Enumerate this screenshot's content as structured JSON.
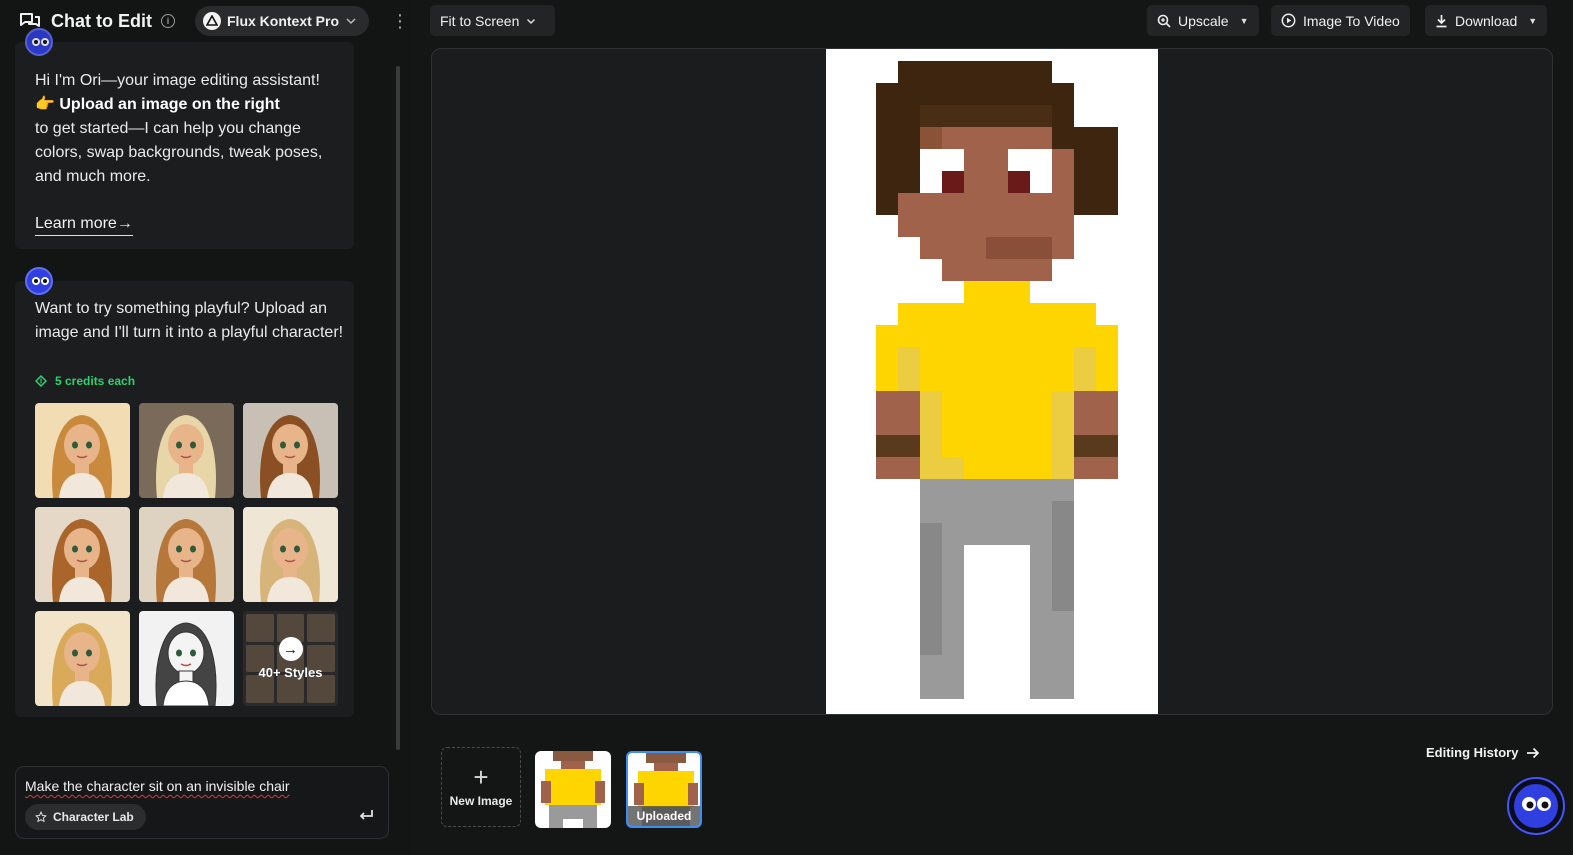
{
  "header": {
    "title": "Chat to Edit",
    "model_name": "Flux Kontext Pro"
  },
  "messages": [
    {
      "intro": "Hi I'm Ori—your image editing assistant!",
      "highlight_emoji": "👉",
      "highlight": "Upload an image on the right",
      "body": "to get started—I can help you change colors, swap backgrounds, tweak poses, and much more.",
      "link": "Learn more",
      "link_arrow": "→"
    },
    {
      "body": "Want to try something playful? Upload an image and I'll turn it into a playful character!",
      "credits": "5 credits each",
      "styles_more": "40+ Styles"
    }
  ],
  "style_thumbs": [
    {
      "icon": "cartoon-girl-style-1",
      "bg": "#f2dcb4",
      "hair": "#c98a3e"
    },
    {
      "icon": "photo-girl-waving-style-2",
      "bg": "#7a6a5a",
      "hair": "#e8d6a8"
    },
    {
      "icon": "cartoon-girl-style-3",
      "bg": "#c9c0b5",
      "hair": "#8a4f22"
    },
    {
      "icon": "cartoon-girl-style-4",
      "bg": "#e6d8c6",
      "hair": "#a9652a"
    },
    {
      "icon": "chibi-girl-style-5",
      "bg": "#ddd3c0",
      "hair": "#b6773a"
    },
    {
      "icon": "anime-girl-style-6",
      "bg": "#efe6d6",
      "hair": "#d6b47a"
    },
    {
      "icon": "cartoon-girl-style-7",
      "bg": "#f2e4c9",
      "hair": "#d9aa5a"
    },
    {
      "icon": "sketch-girl-style-8",
      "bg": "#f2f2f2",
      "hair": "#444444"
    }
  ],
  "input": {
    "value": "Make the character sit on an invisible chair",
    "chip": "Character Lab",
    "send_icon": "enter-icon"
  },
  "toolbar": {
    "fit": "Fit to Screen",
    "upscale": "Upscale",
    "image_to_video": "Image To Video",
    "download": "Download"
  },
  "history": {
    "link": "Editing History",
    "new_image": "New Image",
    "uploaded": "Uploaded"
  },
  "colors": {
    "accent": "#3d8ef0",
    "credits": "#2fd26e",
    "assistant": "#2f3fe0"
  }
}
